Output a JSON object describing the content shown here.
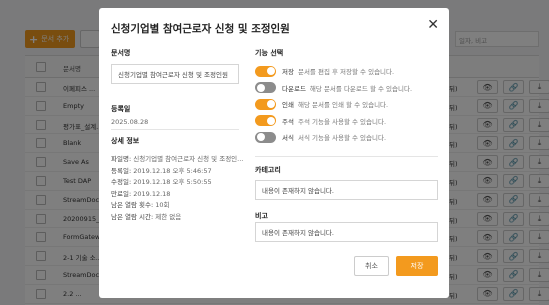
{
  "background": {
    "add_button_label": "문서 추가",
    "search_placeholder": "일자, 비고",
    "column_header": "문서명",
    "rows": [
      {
        "name": "이페피스 ..."
      },
      {
        "name": "Empty"
      },
      {
        "name": "평가표_설계..."
      },
      {
        "name": "Blank"
      },
      {
        "name": "Save As"
      },
      {
        "name": "Test DAP"
      },
      {
        "name": "StreamDoc..."
      },
      {
        "name": "20200915_..."
      },
      {
        "name": "FormGatew..."
      },
      {
        "name": "2-1 기술 소..."
      },
      {
        "name": "StreamDoc..."
      },
      {
        "name": "2.2 ..."
      }
    ],
    "row_trail_text": "뒤)"
  },
  "modal": {
    "title": "신청기업별 참여근로자 신청 및 조정인원",
    "close_icon": "close-icon",
    "doc_name_label": "문서명",
    "doc_name_value": "신청기업별 참여근로자 신청 및 조정인원",
    "reg_date_label": "등록일",
    "reg_date_value": "2025.08.28",
    "detail_label": "상세 정보",
    "details": [
      {
        "key": "파일명",
        "value": "신청기업별 참여근로자 신청 및 조정인..."
      },
      {
        "key": "등록일",
        "value": "2019.12.18 오후 5:46:57"
      },
      {
        "key": "수정일",
        "value": "2019.12.18 오후 5:50:55"
      },
      {
        "key": "만료일",
        "value": "2019.12.18"
      },
      {
        "key": "남은 열람 횟수",
        "value": "10회"
      },
      {
        "key": "남은 열람 시간",
        "value": "제한 없음"
      }
    ],
    "functions_label": "기능 선택",
    "functions": [
      {
        "name": "저장",
        "desc": "문서를 편집 후 저장할 수 있습니다.",
        "on": true
      },
      {
        "name": "다운로드",
        "desc": "해당 문서를 다운로드 할 수 있습니다.",
        "on": false
      },
      {
        "name": "인쇄",
        "desc": "해당 문서를 인쇄 할 수 있습니다.",
        "on": true
      },
      {
        "name": "주석",
        "desc": "주석 기능을 사용할 수 있습니다.",
        "on": true
      },
      {
        "name": "서식",
        "desc": "서식 기능을 사용할 수 있습니다.",
        "on": false
      }
    ],
    "category_label": "카테고리",
    "category_value": "내용이 존재하지 않습니다.",
    "note_label": "비고",
    "note_value": "내용이 존재하지 않습니다.",
    "cancel_label": "취소",
    "save_label": "저장"
  },
  "colors": {
    "accent": "#f39a1e",
    "toggle_off": "#8c8c8c",
    "overlay": "rgba(0,0,0,0.5)"
  }
}
